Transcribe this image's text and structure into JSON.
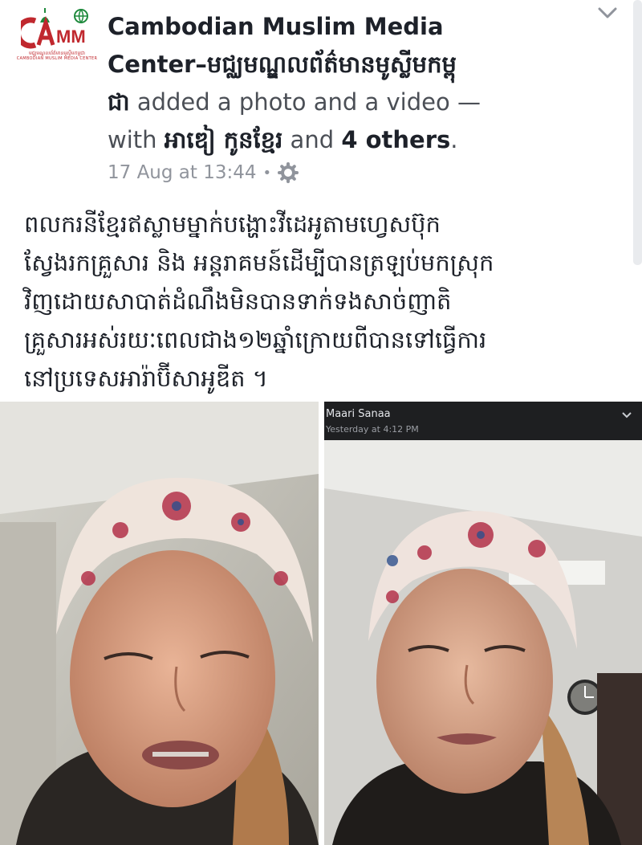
{
  "post": {
    "page_name": "Cambodian Muslim Media Center–មជ្ឈមណ្ឌលព័ត៌មានមូស្លីមកម្ពុជា",
    "page_name_line1": "Cambodian Muslim Media",
    "page_name_line2": "Center–មជ្ឈមណ្ឌលព័ត៌មានមូស្លីមកម្ពុ",
    "page_name_line3": "ជា",
    "action_text": " added a photo and a video —",
    "with_text": "with ",
    "tagged_person": "អាឌៀ កូនខ្មែរ",
    "and_text": " and ",
    "others_text": "4 others",
    "period": ".",
    "timestamp": "17 Aug at 13:44",
    "separator": "•",
    "privacy_icon": "gear-icon",
    "avatar": {
      "logo_text": "CMM",
      "caption_khmer": "មជ្ឈមណ្ឌលព័ត៌មានមូស្លីមកម្ពុជា",
      "caption_english": "CAMBODIAN MUSLIM MEDIA CENTER",
      "colors": {
        "red": "#c0282e",
        "green": "#1f8a3d"
      }
    },
    "body_lines": [
      "ពលករនីខ្មែរឥស្លាមម្នាក់បង្ហោះវីដេអូតាមហ្វេសប៊ុក",
      "ស្វែងរកគ្រួសារ និង អន្តរាគមន៍ដើម្បីបានត្រឡប់មកស្រុក",
      "វិញដោយសាបាត់ដំណឹងមិនបានទាក់ទងសាច់ញាតិ",
      "គ្រួសារអស់រយៈពេលជាង១២ឆ្នាំក្រោយពីបានទៅធ្វើការ",
      "នៅប្រទេសអារ៉ាប៊ីសាអូឌីត ។"
    ]
  },
  "media": {
    "video_chat": {
      "contact_name": "Maari Sanaa",
      "time": "Yesterday at 4:12 PM"
    }
  }
}
